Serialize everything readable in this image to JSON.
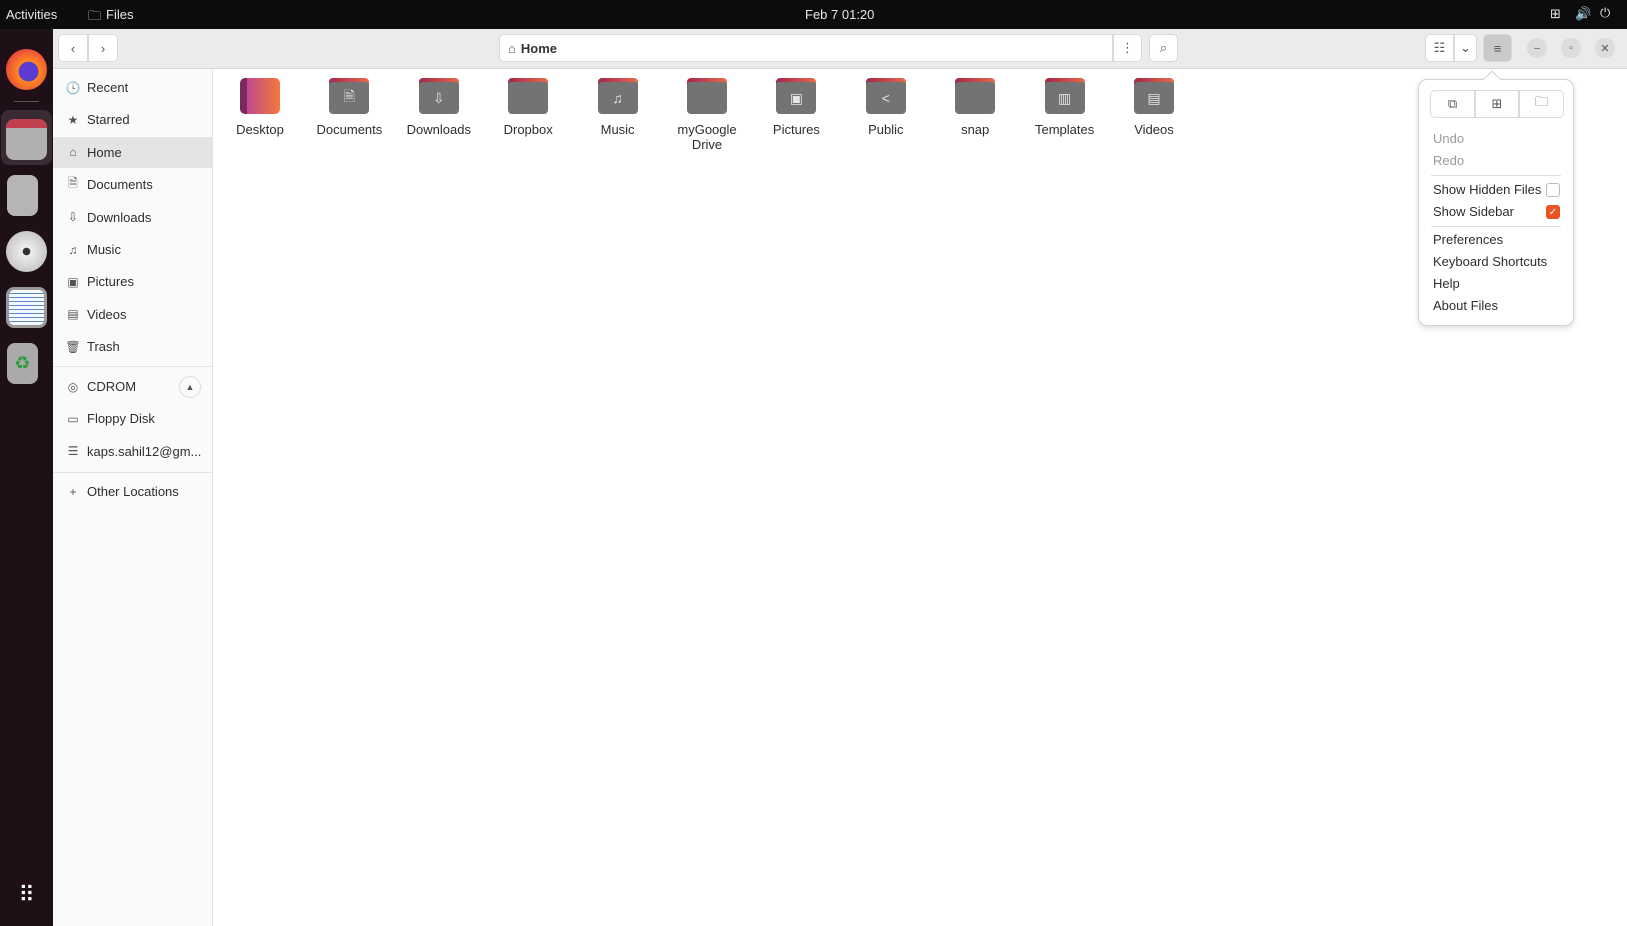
{
  "topbar": {
    "activities": "Activities",
    "app": "Files",
    "clock": "Feb 7  01:20",
    "icons": [
      "network-icon",
      "volume-icon",
      "power-icon"
    ]
  },
  "dock": [
    "firefox",
    "files",
    "text-editor",
    "cdrom",
    "floppy",
    "trash",
    "app-grid"
  ],
  "header": {
    "path": "Home"
  },
  "sidebar": {
    "places": [
      {
        "label": "Recent",
        "icon": "🕓"
      },
      {
        "label": "Starred",
        "icon": "★"
      },
      {
        "label": "Home",
        "icon": "⌂"
      },
      {
        "label": "Documents",
        "icon": "🗎"
      },
      {
        "label": "Downloads",
        "icon": "⇩"
      },
      {
        "label": "Music",
        "icon": "♫"
      },
      {
        "label": "Pictures",
        "icon": "▣"
      },
      {
        "label": "Videos",
        "icon": "▤"
      },
      {
        "label": "Trash",
        "icon": "🗑"
      }
    ],
    "devices": [
      {
        "label": "CDROM",
        "icon": "◎"
      },
      {
        "label": "Floppy Disk",
        "icon": "▭"
      },
      {
        "label": "kaps.sahil12@gm...",
        "icon": "☰"
      }
    ],
    "other": {
      "label": "Other Locations",
      "icon": "+"
    },
    "selected": "Home"
  },
  "files": [
    {
      "name": "Desktop",
      "glyph": ""
    },
    {
      "name": "Documents",
      "glyph": "🗎"
    },
    {
      "name": "Downloads",
      "glyph": "⇩"
    },
    {
      "name": "Dropbox",
      "glyph": ""
    },
    {
      "name": "Music",
      "glyph": "♫"
    },
    {
      "name": "myGoogleDrive",
      "glyph": ""
    },
    {
      "name": "Pictures",
      "glyph": "▣"
    },
    {
      "name": "Public",
      "glyph": "<"
    },
    {
      "name": "snap",
      "glyph": ""
    },
    {
      "name": "Templates",
      "glyph": "▥"
    },
    {
      "name": "Videos",
      "glyph": "▤"
    }
  ],
  "menu": {
    "undo": "Undo",
    "redo": "Redo",
    "show_hidden": "Show Hidden Files",
    "show_hidden_checked": false,
    "show_sidebar": "Show Sidebar",
    "show_sidebar_checked": true,
    "preferences": "Preferences",
    "shortcuts": "Keyboard Shortcuts",
    "help": "Help",
    "about": "About Files"
  },
  "colors": {
    "accent": "#e95420"
  }
}
